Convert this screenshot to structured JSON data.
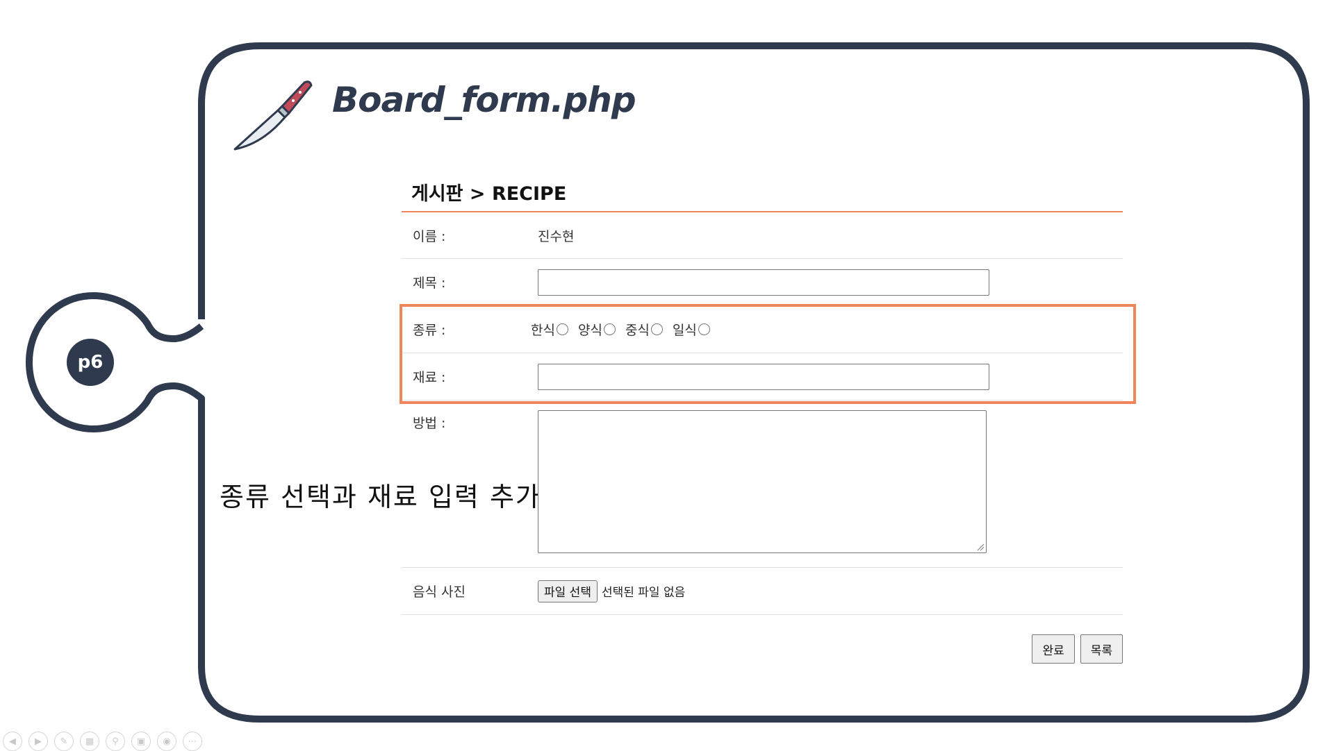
{
  "slide": {
    "title": "Board_form.php",
    "page_badge": "p6",
    "caption": "종류 선택과 재료 입력 추가",
    "frame_color": "#2f3a4e",
    "accent_color": "#f0845a"
  },
  "board": {
    "header": "게시판 > RECIPE",
    "name_label": "이름 :",
    "name_value": "진수현",
    "title_label": "제목 :",
    "type_label": "종류 :",
    "type_options": [
      "한식",
      "양식",
      "중식",
      "일식"
    ],
    "ingredients_label": "재료 :",
    "method_label": "방법 :",
    "photo_label": "음식 사진",
    "file_button": "파일 선택",
    "file_status": "선택된 파일 없음",
    "submit_button": "완료",
    "list_button": "목록"
  },
  "toolbar": {
    "icons": [
      "prev-icon",
      "next-icon",
      "pen-icon",
      "slides-icon",
      "zoom-icon",
      "subtitle-icon",
      "camera-icon",
      "more-icon"
    ]
  }
}
